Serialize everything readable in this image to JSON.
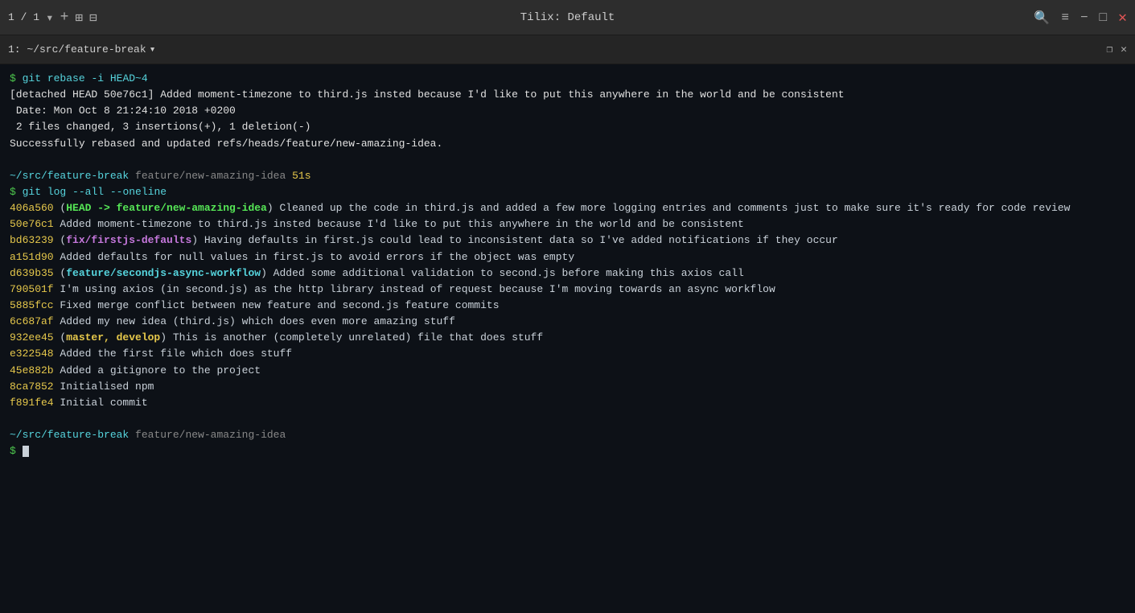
{
  "titlebar": {
    "tab_indicator": "1 / 1",
    "title": "Tilix: Default",
    "icons": {
      "plus": "+",
      "new_tab": "⊞",
      "split": "⊟",
      "search": "🔍",
      "menu": "≡",
      "minimize": "−",
      "maximize": "□",
      "close": "✕"
    }
  },
  "session": {
    "label": "1: ~/src/feature-break",
    "dropdown": "▾",
    "right_icons": {
      "restore": "❐",
      "close": "✕"
    }
  },
  "terminal": {
    "command1": "git rebase -i HEAD~4",
    "output": [
      "[detached HEAD 50e76c1] Added moment-timezone to third.js insted because I'd like to put this anywhere in the world and be consistent",
      " Date: Mon Oct 8 21:24:10 2018 +0200",
      " 2 files changed, 3 insertions(+), 1 deletion(-)",
      "Successfully rebased and updated refs/heads/feature/new-amazing-idea."
    ],
    "prompt1_path": "~/src/feature-break",
    "prompt1_branch": "feature/new-amazing-idea",
    "prompt1_time": "51s",
    "command2": "git log --all --oneline",
    "log_entries": [
      {
        "hash": "406a560",
        "branch": "HEAD -> feature/new-amazing-idea",
        "branch_color": "head",
        "message": "Cleaned up the code in third.js and added a few more logging entries and comments just to make sure it's ready for code review"
      },
      {
        "hash": "50e76c1",
        "branch": "",
        "message": "Added moment-timezone to third.js insted because I'd like to put this anywhere in the world and be consistent"
      },
      {
        "hash": "bd63239",
        "branch": "fix/firstjs-defaults",
        "branch_color": "fix",
        "message": "Having defaults in first.js could lead to inconsistent data so I've added notifications if they occur"
      },
      {
        "hash": "a151d90",
        "branch": "",
        "message": "Added defaults for null values in first.js to avoid errors if the object was empty"
      },
      {
        "hash": "d639b35",
        "branch": "feature/secondjs-async-workflow",
        "branch_color": "feature2",
        "message": "Added some additional validation to second.js before making this axios call"
      },
      {
        "hash": "790501f",
        "branch": "",
        "message": "I'm using axios (in second.js) as the http library instead of request because I'm moving towards an async workflow"
      },
      {
        "hash": "5885fcc",
        "branch": "",
        "message": "Fixed merge conflict between new feature and second.js feature commits"
      },
      {
        "hash": "6c687af",
        "branch": "",
        "message": "Added my new idea (third.js) which does even more amazing stuff"
      },
      {
        "hash": "932ee45",
        "branch": "master, develop",
        "branch_color": "master",
        "message": "This is another (completely unrelated) file that does stuff"
      },
      {
        "hash": "e322548",
        "branch": "",
        "message": "Added the first file which does stuff"
      },
      {
        "hash": "45e882b",
        "branch": "",
        "message": "Added a gitignore to the project"
      },
      {
        "hash": "8ca7852",
        "branch": "",
        "message": "Initialised npm"
      },
      {
        "hash": "f891fe4",
        "branch": "",
        "message": "Initial commit"
      }
    ],
    "prompt2_path": "~/src/feature-break",
    "prompt2_branch": "feature/new-amazing-idea",
    "final_prompt": "$"
  }
}
